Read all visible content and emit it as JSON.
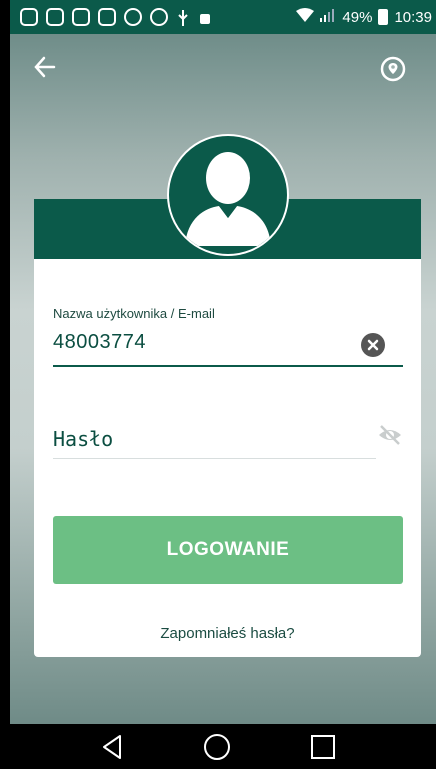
{
  "status_bar": {
    "battery_percent": "49%",
    "time": "10:39",
    "icons": [
      "instagram-icon",
      "gallery-icon",
      "instagram-icon",
      "instagram-icon",
      "messenger-icon",
      "e-icon",
      "usb-icon",
      "android-debug-icon"
    ]
  },
  "login_form": {
    "username_label": "Nazwa użytkownika / E-mail",
    "username_value": "48003774",
    "password_placeholder": "Hasło",
    "login_button_label": "LOGOWANIE",
    "forgot_password_label": "Zapomniałeś hasła?"
  },
  "colors": {
    "primary": "#0b5a4a",
    "button": "#6cbf84"
  }
}
